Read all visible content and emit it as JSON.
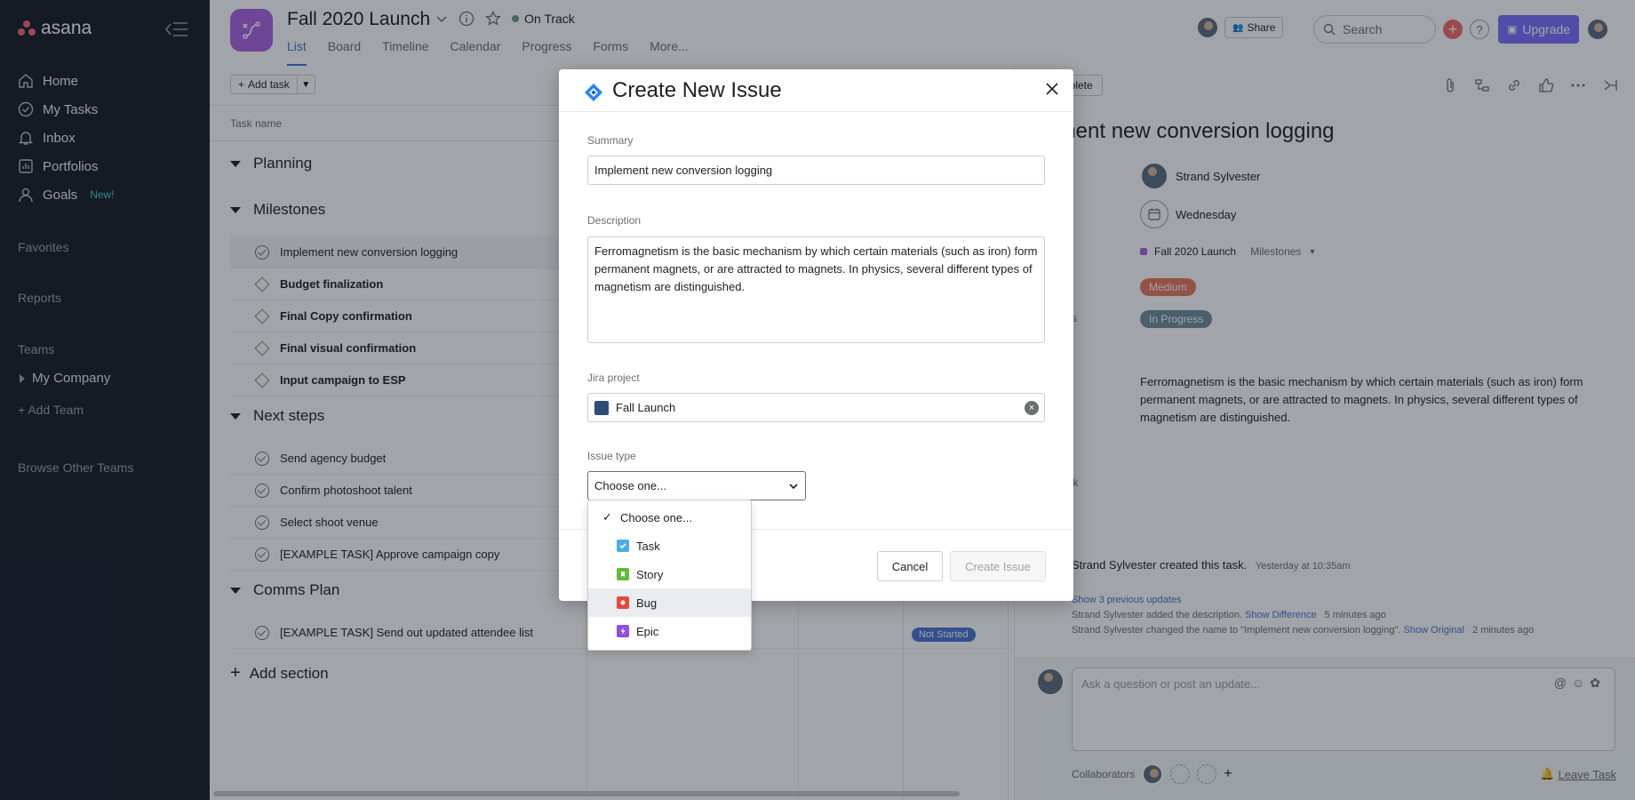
{
  "sidebar": {
    "brand": "asana",
    "nav": [
      {
        "label": "Home",
        "icon": "home-icon"
      },
      {
        "label": "My Tasks",
        "icon": "check-circle-icon"
      },
      {
        "label": "Inbox",
        "icon": "bell-icon"
      },
      {
        "label": "Portfolios",
        "icon": "bar-chart-icon"
      },
      {
        "label": "Goals",
        "icon": "person-icon",
        "badge": "New!"
      }
    ],
    "favorites": "Favorites",
    "reports": "Reports",
    "teams": "Teams",
    "company": "My Company",
    "add_team": "Add Team",
    "browse": "Browse Other Teams"
  },
  "project": {
    "title": "Fall 2020 Launch",
    "status": "On Track",
    "tabs": [
      "List",
      "Board",
      "Timeline",
      "Calendar",
      "Progress",
      "Forms",
      "More..."
    ],
    "active_tab": "List"
  },
  "topbar": {
    "share": "Share",
    "search_placeholder": "Search",
    "help": "?",
    "upgrade": "Upgrade"
  },
  "list": {
    "add_task": "Add task",
    "col_task_name": "Task name",
    "sections": [
      {
        "name": "Planning",
        "tasks": []
      },
      {
        "name": "Milestones",
        "tasks": [
          {
            "name": "Implement new conversion logging",
            "kind": "task",
            "highlight": true
          },
          {
            "name": "Budget finalization",
            "kind": "milestone"
          },
          {
            "name": "Final Copy confirmation",
            "kind": "milestone"
          },
          {
            "name": "Final visual confirmation",
            "kind": "milestone"
          },
          {
            "name": "Input campaign to ESP",
            "kind": "milestone"
          }
        ]
      },
      {
        "name": "Next steps",
        "tasks": [
          {
            "name": "Send agency budget",
            "kind": "task"
          },
          {
            "name": "Confirm photoshoot talent",
            "kind": "task"
          },
          {
            "name": "Select shoot venue",
            "kind": "task"
          },
          {
            "name": "[EXAMPLE TASK] Approve campaign copy",
            "kind": "task"
          }
        ]
      },
      {
        "name": "Comms Plan",
        "tasks": [
          {
            "name": "[EXAMPLE TASK] Send out updated attendee list",
            "kind": "task"
          }
        ]
      }
    ],
    "not_started": "Not Started",
    "add_section": "Add section"
  },
  "detail": {
    "mark_complete": "rk Complete",
    "title": "lement new conversion logging",
    "fields": [
      {
        "label": "e",
        "value": "Strand Sylvester"
      },
      {
        "label": "te",
        "value": "Wednesday"
      },
      {
        "label": "s",
        "value": "Fall 2020 Launch",
        "extra": "Milestones"
      },
      {
        "label": "",
        "value": "Medium",
        "pill_color": "#e8775e"
      },
      {
        "label": "rogress",
        "value": "In Progress",
        "pill_color": "#6f8a99"
      },
      {
        "label": "ver",
        "value": ""
      },
      {
        "label": "tion",
        "value": ""
      }
    ],
    "description": "Ferromagnetism is the basic mechanism by which certain materials (such as iron) form permanent magnets, or are attracted to magnets. In physics, several different types of magnetism are distinguished.",
    "subtask_label": "subtask",
    "activity": {
      "created": "Strand Sylvester created this task.",
      "created_time": "Yesterday at 10:35am",
      "show_prev": "Show 3 previous updates",
      "line1_prefix": "Strand Sylvester added the description.",
      "line1_link": "Show Difference",
      "line1_time": "5 minutes ago",
      "line2_prefix": "Strand Sylvester changed the name to \"Implement new conversion logging\".",
      "line2_link": "Show Original",
      "line2_time": "2 minutes ago"
    },
    "comment_placeholder": "Ask a question or post an update...",
    "collaborators": "Collaborators",
    "leave_task": "Leave Task"
  },
  "modal": {
    "title": "Create New Issue",
    "summary_label": "Summary",
    "summary_value": "Implement new conversion logging",
    "description_label": "Description",
    "description_value": "Ferromagnetism is the basic mechanism by which certain materials (such as iron) form permanent magnets, or are attracted to magnets. In physics, several different types of magnetism are distinguished.",
    "jira_project_label": "Jira project",
    "jira_project_value": "Fall Launch",
    "issue_type_label": "Issue type",
    "issue_type_value": "Choose one...",
    "options": [
      {
        "label": "Choose one...",
        "checked": true
      },
      {
        "label": "Task",
        "color": "#4bade8",
        "icon": "task-icon"
      },
      {
        "label": "Story",
        "color": "#63ba3c",
        "icon": "story-icon"
      },
      {
        "label": "Bug",
        "color": "#e5493a",
        "icon": "bug-icon",
        "hover": true
      },
      {
        "label": "Epic",
        "color": "#904ee2",
        "icon": "epic-icon"
      }
    ],
    "cancel": "Cancel",
    "create": "Create Issue"
  }
}
